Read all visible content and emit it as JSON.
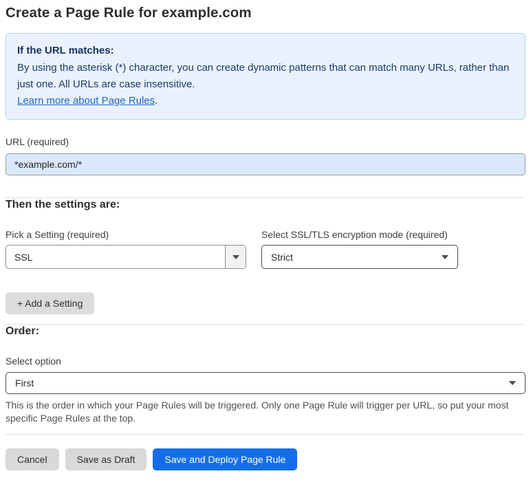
{
  "page": {
    "title": "Create a Page Rule for example.com"
  },
  "info_box": {
    "heading": "If the URL matches:",
    "body": "By using the asterisk (*) character, you can create dynamic patterns that can match many URLs, rather than just one. All URLs are case insensitive.",
    "link_label": "Learn more about Page Rules",
    "link_suffix": "."
  },
  "url_field": {
    "label": "URL (required)",
    "value": "*example.com/*"
  },
  "settings": {
    "heading": "Then the settings are:",
    "pick_setting": {
      "label": "Pick a Setting (required)",
      "selected": "SSL"
    },
    "encryption_mode": {
      "label": "Select SSL/TLS encryption mode (required)",
      "selected": "Strict"
    },
    "add_setting_label": "+ Add a Setting"
  },
  "order": {
    "heading": "Order:",
    "select_label": "Select option",
    "selected": "First",
    "help_text": "This is the order in which your Page Rules will be triggered. Only one Page Rule will trigger per URL, so put your most specific Page Rules at the top."
  },
  "actions": {
    "cancel_label": "Cancel",
    "save_draft_label": "Save as Draft",
    "save_deploy_label": "Save and Deploy Page Rule"
  },
  "colors": {
    "primary_blue": "#156ee9",
    "info_box_bg": "#e9f2fc",
    "info_box_border": "#b3d3ef",
    "info_text_navy": "#1a3a6b",
    "link_blue": "#2166c0",
    "url_input_bg": "#dce9fc",
    "gray_button_bg": "#d9d9d9"
  }
}
